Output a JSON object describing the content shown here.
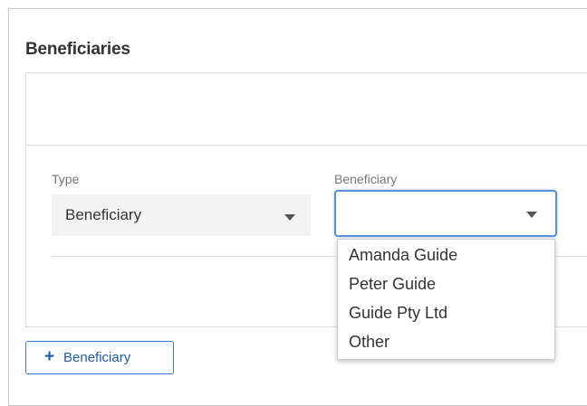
{
  "section": {
    "title": "Beneficiaries"
  },
  "form": {
    "type_label": "Type",
    "type_value": "Beneficiary",
    "beneficiary_label": "Beneficiary",
    "beneficiary_value": ""
  },
  "dropdown": {
    "options": [
      "Amanda Guide",
      "Peter Guide",
      "Guide Pty Ltd",
      "Other"
    ]
  },
  "actions": {
    "add_beneficiary_label": "Beneficiary",
    "add_icon": "+"
  },
  "colors": {
    "accent": "#3d78c7",
    "focus_border": "#5b8fd6",
    "select_bg": "#f3f3f3"
  }
}
